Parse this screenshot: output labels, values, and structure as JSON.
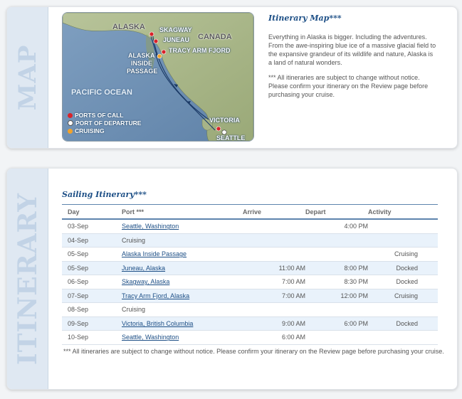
{
  "map_panel": {
    "tab_label": "MAP",
    "heading": "Itinerary Map***",
    "description": "Everything in Alaska is bigger. Including the adventures. From the awe-inspiring blue ice of a massive glacial field to the expansive grandeur of its wildlife and nature, Alaska is a land of natural wonders.",
    "disclaimer": "*** All itineraries are subject to change without notice. Please confirm your itinerary on the Review page before purchasing your cruise.",
    "map": {
      "region_labels": {
        "alaska": "ALASKA",
        "canada": "CANADA",
        "ocean": "PACIFIC OCEAN"
      },
      "place_labels": {
        "skagway": "SKAGWAY",
        "juneau": "JUNEAU",
        "tracy_arm": "TRACY ARM FJORD",
        "inside_passage_1": "ALASKA",
        "inside_passage_2": "INSIDE",
        "inside_passage_3": "PASSAGE",
        "victoria": "VICTORIA",
        "seattle": "SEATTLE"
      },
      "legend": [
        {
          "label": "PORTS OF CALL",
          "color": "#d8232a"
        },
        {
          "label": "PORT OF DEPARTURE",
          "color": "#ffffff"
        },
        {
          "label": "CRUISING",
          "color": "#f2a22a"
        }
      ]
    }
  },
  "itinerary_panel": {
    "tab_label": "ITINERARY",
    "heading": "Sailing Itinerary***",
    "columns": {
      "day": "Day",
      "port": "Port ***",
      "arrive": "Arrive",
      "depart": "Depart",
      "activity": "Activity"
    },
    "rows": [
      {
        "day": "03-Sep",
        "port": "Seattle, Washington",
        "arrive": "",
        "depart": "4:00 PM",
        "activity": ""
      },
      {
        "day": "04-Sep",
        "port": "Cruising",
        "arrive": "",
        "depart": "",
        "activity": ""
      },
      {
        "day": "05-Sep",
        "port": "Alaska Inside Passage",
        "arrive": "",
        "depart": "",
        "activity": "Cruising"
      },
      {
        "day": "05-Sep",
        "port": "Juneau, Alaska",
        "arrive": "11:00 AM",
        "depart": "8:00 PM",
        "activity": "Docked"
      },
      {
        "day": "06-Sep",
        "port": "Skagway, Alaska",
        "arrive": "7:00 AM",
        "depart": "8:30 PM",
        "activity": "Docked"
      },
      {
        "day": "07-Sep",
        "port": "Tracy Arm Fjord, Alaska",
        "arrive": "7:00 AM",
        "depart": "12:00 PM",
        "activity": "Cruising"
      },
      {
        "day": "08-Sep",
        "port": "Cruising",
        "arrive": "",
        "depart": "",
        "activity": ""
      },
      {
        "day": "09-Sep",
        "port": "Victoria, British Columbia",
        "arrive": "9:00 AM",
        "depart": "6:00 PM",
        "activity": "Docked"
      },
      {
        "day": "10-Sep",
        "port": "Seattle, Washington",
        "arrive": "6:00 AM",
        "depart": "",
        "activity": ""
      }
    ],
    "footnote": "*** All itineraries are subject to change without notice. Please confirm your itinerary on the Review page before purchasing your cruise."
  }
}
